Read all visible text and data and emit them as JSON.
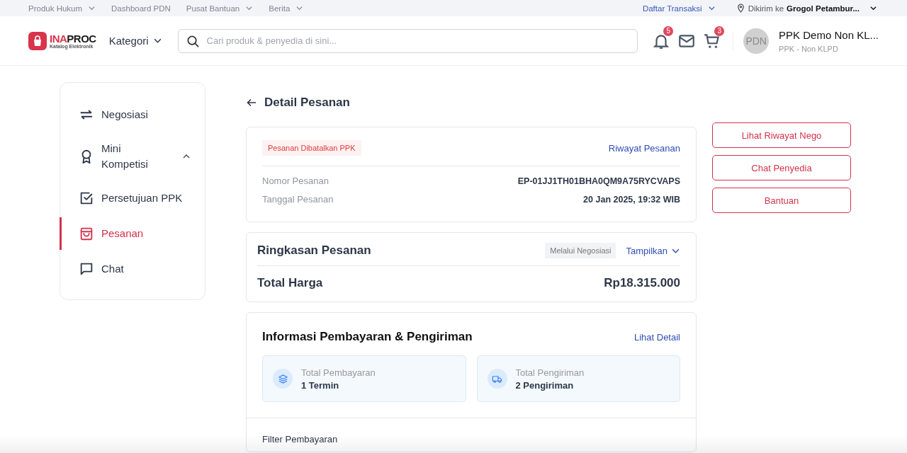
{
  "top_links": [
    {
      "label": "Produk Hukum",
      "dropdown": true
    },
    {
      "label": "Dashboard PDN",
      "dropdown": false
    },
    {
      "label": "Pusat Bantuan",
      "dropdown": true
    },
    {
      "label": "Berita",
      "dropdown": true
    }
  ],
  "transactions_link": "Daftar Transaksi",
  "delivery": {
    "prefix": "Dikirim ke",
    "location": "Grogol Petambur..."
  },
  "logo": {
    "part_a": "INA",
    "part_b": "PROC",
    "tagline": "Katalog Elektronik"
  },
  "category_menu": "Kategori",
  "search": {
    "placeholder": "Cari produk & penyedia di sini..."
  },
  "notifications": {
    "badge": "5"
  },
  "cart": {
    "badge": "3"
  },
  "user": {
    "avatar": "PDN",
    "name": "PPK Demo Non KL...",
    "role": "PPK - Non KLPD"
  },
  "sidebar": {
    "items": [
      {
        "label": "Negosiasi",
        "kind": "swap",
        "selected": false
      },
      {
        "label": "Mini Kompetisi",
        "kind": "award",
        "selected": false,
        "expanded": true
      },
      {
        "label": "Persetujuan PPK",
        "kind": "checkbox",
        "selected": false
      },
      {
        "label": "Pesanan",
        "kind": "bag",
        "selected": true
      },
      {
        "label": "Chat",
        "kind": "chat",
        "selected": false
      }
    ]
  },
  "page_title": "Detail Pesanan",
  "order": {
    "status": "Pesanan Dibatalkan PPK",
    "history_link": "Riwayat Pesanan",
    "fields": [
      {
        "label": "Nomor Pesanan",
        "value": "EP-01JJ1TH01BHA0QM9A75RYCVAPS"
      },
      {
        "label": "Tanggal Pesanan",
        "value": "20 Jan 2025, 19:32 WIB"
      }
    ]
  },
  "summary": {
    "title": "Ringkasan Pesanan",
    "tag": "Melalui Negosiasi",
    "toggle": "Tampilkan",
    "expanded": false,
    "total_label": "Total Harga",
    "total_value": "Rp18.315.000"
  },
  "payment_shipping": {
    "title": "Informasi Pembayaran & Pengiriman",
    "link": "Lihat Detail",
    "tiles": [
      {
        "kind": "layers",
        "label": "Total Pembayaran",
        "value": "1 Termin"
      },
      {
        "kind": "truck",
        "label": "Total Pengiriman",
        "value": "2 Pengiriman"
      }
    ],
    "filter_label": "Filter Pembayaran"
  },
  "actions": [
    "Lihat Riwayat Nego",
    "Chat Penyedia",
    "Bantuan"
  ]
}
